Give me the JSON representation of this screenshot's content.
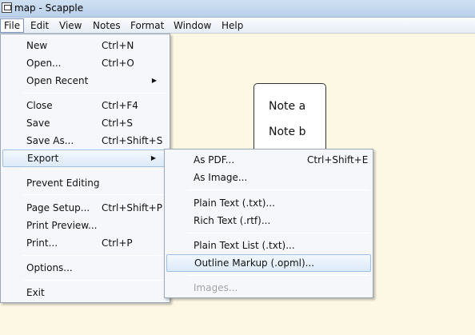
{
  "window": {
    "title": "map - Scapple"
  },
  "menubar": {
    "file": "File",
    "edit": "Edit",
    "view": "View",
    "notes": "Notes",
    "format": "Format",
    "window": "Window",
    "help": "Help"
  },
  "note": {
    "line1": "Note a",
    "line2": "Note b"
  },
  "file_menu": {
    "new": {
      "label": "New",
      "shortcut": "Ctrl+N"
    },
    "open": {
      "label": "Open...",
      "shortcut": "Ctrl+O"
    },
    "open_recent": {
      "label": "Open Recent"
    },
    "close": {
      "label": "Close",
      "shortcut": "Ctrl+F4"
    },
    "save": {
      "label": "Save",
      "shortcut": "Ctrl+S"
    },
    "save_as": {
      "label": "Save As...",
      "shortcut": "Ctrl+Shift+S"
    },
    "export": {
      "label": "Export"
    },
    "prevent_editing": {
      "label": "Prevent Editing"
    },
    "page_setup": {
      "label": "Page Setup...",
      "shortcut": "Ctrl+Shift+P"
    },
    "print_preview": {
      "label": "Print Preview..."
    },
    "print": {
      "label": "Print...",
      "shortcut": "Ctrl+P"
    },
    "options": {
      "label": "Options..."
    },
    "exit": {
      "label": "Exit"
    }
  },
  "export_menu": {
    "as_pdf": {
      "label": "As PDF...",
      "shortcut": "Ctrl+Shift+E"
    },
    "as_image": {
      "label": "As Image..."
    },
    "plain_text": {
      "label": "Plain Text (.txt)..."
    },
    "rich_text": {
      "label": "Rich Text (.rtf)..."
    },
    "plain_text_list": {
      "label": "Plain Text List (.txt)..."
    },
    "outline_markup": {
      "label": "Outline Markup (.opml)..."
    },
    "images": {
      "label": "Images..."
    }
  },
  "icons": {
    "app": "scapple-app-icon",
    "submenu": "submenu-arrow-icon"
  },
  "colors": {
    "canvas_bg": "#fdf8e4",
    "highlight_border": "#9fc0e6",
    "disabled_text": "#a3a3a3"
  }
}
